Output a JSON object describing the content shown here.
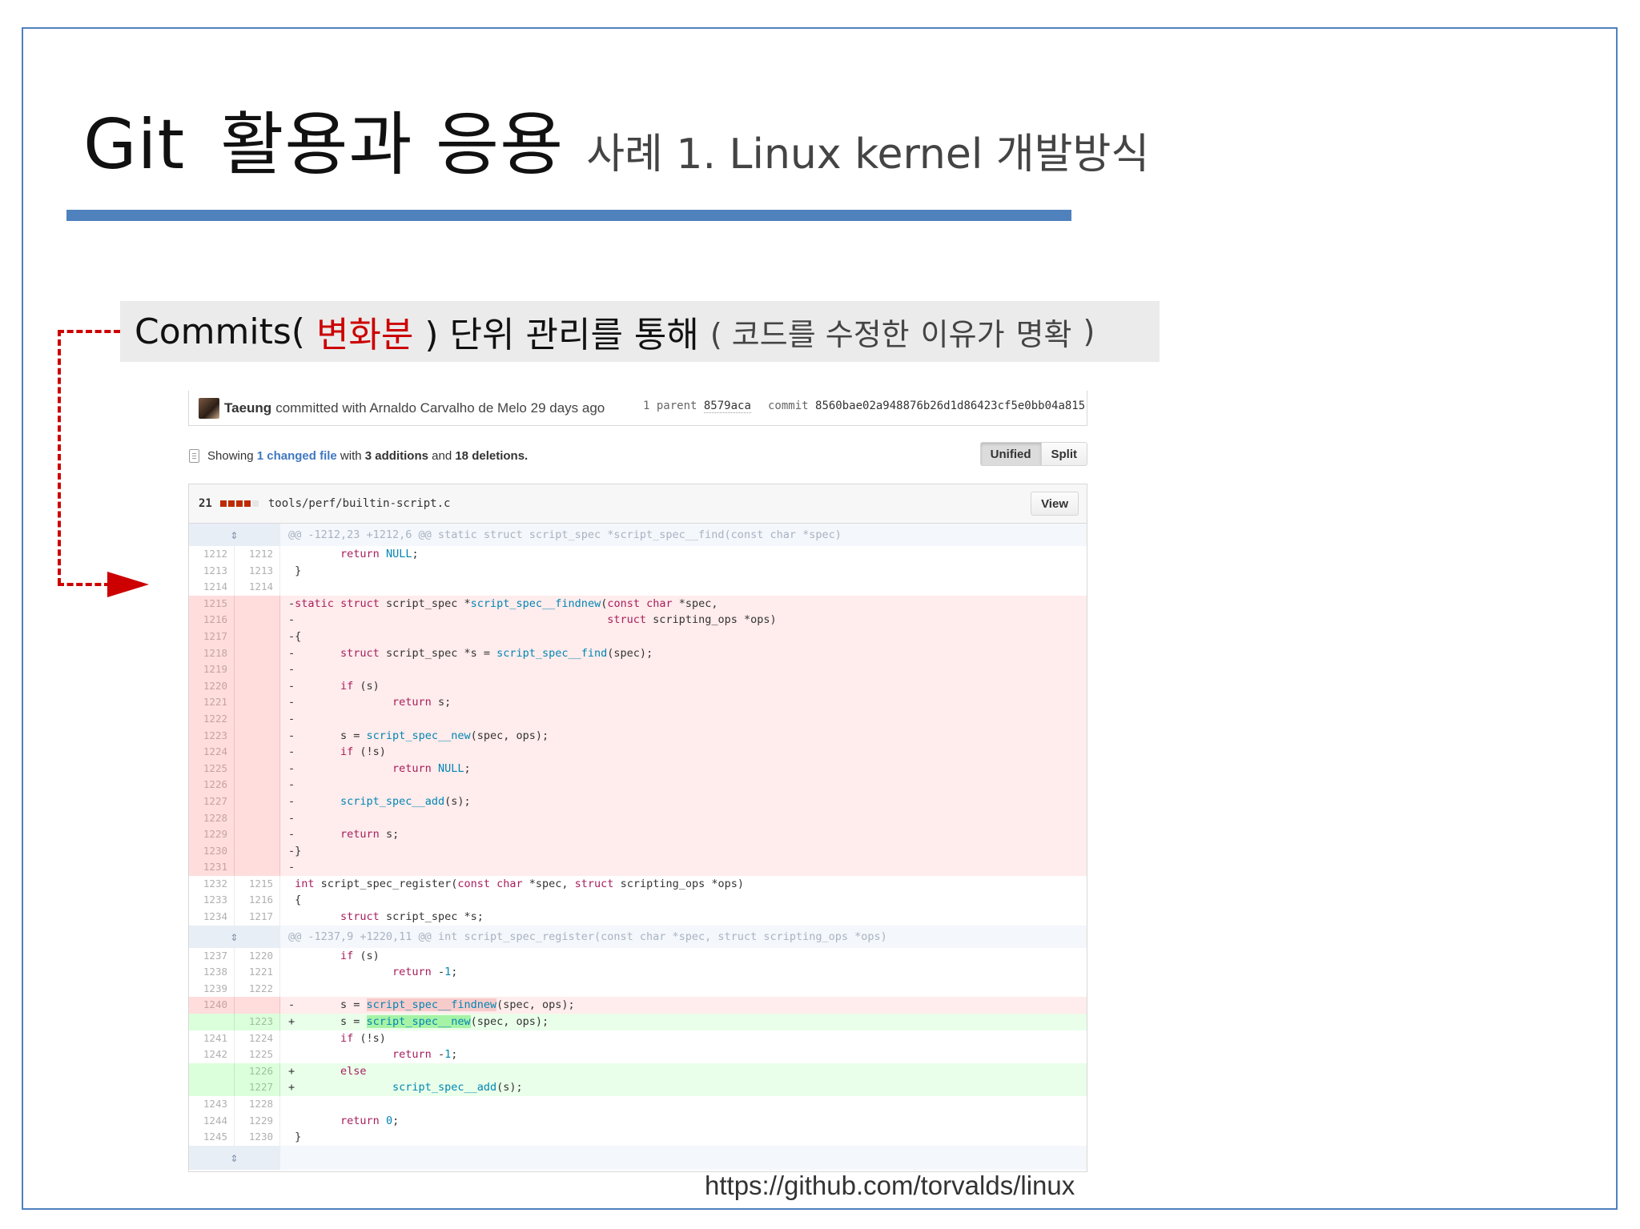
{
  "slide": {
    "title": {
      "main_a": "Git",
      "main_b": "활용과 응용",
      "sub": "사례 1. Linux kernel  개발방식"
    },
    "banner": {
      "part1": "Commits(",
      "part2": "변화분",
      "part3": ") 단위 관리를 통해",
      "part4": "( 코드를 수정한",
      "part5": "이유",
      "part6": "가",
      "part7": "명확",
      "part8": ")"
    },
    "source_url": "https://github.com/torvalds/linux",
    "colors": {
      "accent_blue": "#4f81bd",
      "highlight_red": "#cc0000"
    }
  },
  "commit": {
    "author": "Taeung",
    "rest": "committed with Arnaldo Carvalho de Melo 29 days ago",
    "parent_label": "1 parent",
    "parent_hash": "8579aca",
    "commit_label": "commit",
    "commit_hash": "8560bae02a948876b26d1d86423cf5e0bb04a815"
  },
  "summary": {
    "showing": "Showing",
    "changed": "1 changed file",
    "with": "with",
    "additions": "3 additions",
    "and": "and",
    "deletions": "18 deletions.",
    "unified_label": "Unified",
    "split_label": "Split"
  },
  "file": {
    "change_count": "21",
    "path": "tools/perf/builtin-script.c",
    "view_label": "View"
  },
  "hunks": {
    "h1": "@@ -1212,23 +1212,6 @@ static struct script_spec *script_spec__find(const char *spec)",
    "h2": "@@ -1237,9 +1220,11 @@ int script_spec_register(const char *spec, struct scripting_ops *ops)"
  },
  "icons": {
    "expand": "expand-arrows-icon",
    "file": "file-icon",
    "avatar": "user-avatar"
  }
}
